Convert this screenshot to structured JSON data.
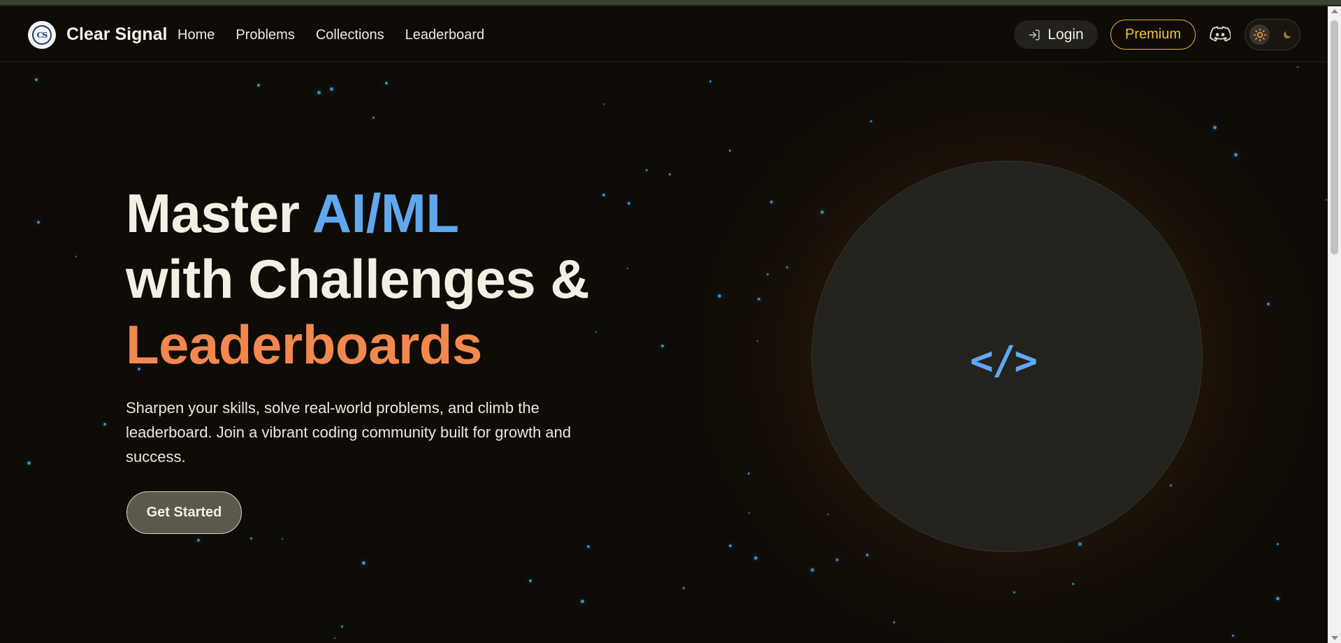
{
  "brand": {
    "name": "Clear Signal",
    "logo_text": "CS"
  },
  "nav": {
    "links": [
      {
        "label": "Home"
      },
      {
        "label": "Problems"
      },
      {
        "label": "Collections"
      },
      {
        "label": "Leaderboard"
      }
    ],
    "login_label": "Login",
    "premium_label": "Premium"
  },
  "hero": {
    "title_part1": "Master ",
    "title_highlight1": "AI/ML",
    "title_part2": "with Challenges &",
    "title_highlight2": "Leaderboards",
    "subtitle": "Sharpen your skills, solve real-world problems, and climb the leaderboard. Join a vibrant coding community built for growth and success.",
    "cta_label": "Get Started",
    "code_symbol": "</>"
  },
  "colors": {
    "accent_blue": "#5fa8ef",
    "accent_orange": "#f2884f",
    "premium_gold": "#f0c040",
    "background": "#0f0c07",
    "star": "#3e9bd4"
  },
  "icons": {
    "logo": "logo-icon",
    "login": "login-icon",
    "discord": "discord-icon",
    "sun": "sun-icon",
    "moon": "moon-icon",
    "code": "code-icon"
  }
}
